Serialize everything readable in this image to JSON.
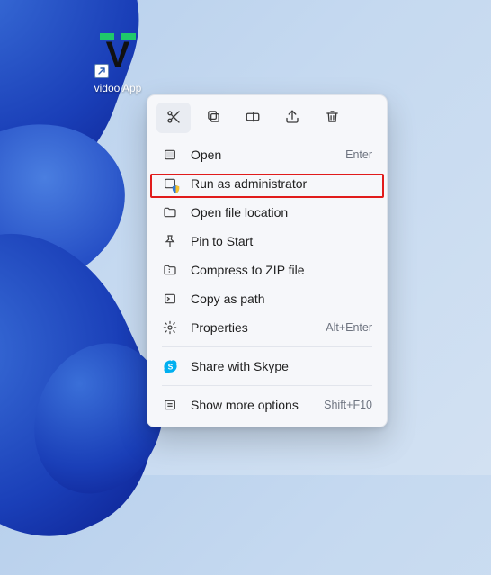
{
  "desktop": {
    "icon_name": "vidoo App",
    "logo_letter": "V"
  },
  "action_bar": {
    "cut": "cut-icon",
    "copy": "copy-icon",
    "rename": "rename-icon",
    "share": "share-icon",
    "delete": "delete-icon"
  },
  "menu": {
    "open": {
      "label": "Open",
      "accel": "Enter"
    },
    "run_admin": {
      "label": "Run as administrator"
    },
    "open_loc": {
      "label": "Open file location"
    },
    "pin_start": {
      "label": "Pin to Start"
    },
    "zip": {
      "label": "Compress to ZIP file"
    },
    "copy_path": {
      "label": "Copy as path"
    },
    "properties": {
      "label": "Properties",
      "accel": "Alt+Enter"
    },
    "skype": {
      "label": "Share with Skype"
    },
    "more": {
      "label": "Show more options",
      "accel": "Shift+F10"
    }
  },
  "highlight": {
    "target": "run_admin"
  }
}
